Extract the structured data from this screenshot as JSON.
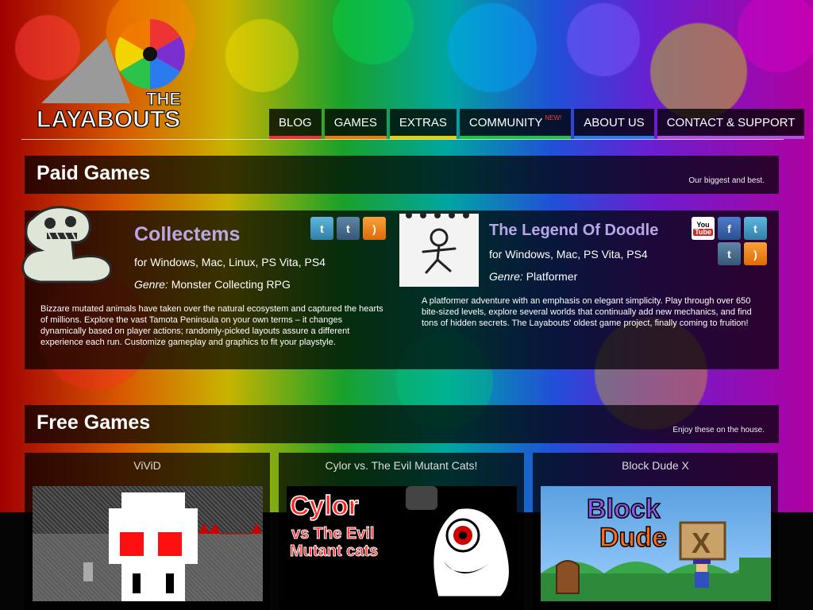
{
  "colors": {
    "nav_blog": "#e33",
    "nav_games": "#f07a00",
    "nav_extras": "#e6cf00",
    "nav_community": "#1ec23c",
    "nav_about": "#2a7bf0",
    "nav_contact": "#b050e0",
    "title_link": "#b9a6e6"
  },
  "logo": {
    "text": "THE LAYABOUTS"
  },
  "nav": [
    {
      "label": "BLOG"
    },
    {
      "label": "GAMES"
    },
    {
      "label": "EXTRAS"
    },
    {
      "label": "COMMUNITY",
      "badge": "NEW!"
    },
    {
      "label": "ABOUT US"
    },
    {
      "label": "CONTACT & SUPPORT"
    }
  ],
  "paid": {
    "heading": "Paid Games",
    "tagline": "Our biggest and best.",
    "games": [
      {
        "title": "Collectems",
        "platforms": "for Windows, Mac, Linux, PS Vita, PS4",
        "genre_label": "Genre:",
        "genre": " Monster Collecting RPG",
        "description": "Bizzare mutated animals have taken over the natural ecosystem and captured the hearts of millions. Explore the vast Tamota Peninsula on your own terms – it changes dynamically based on player actions; randomly-picked layouts assure a different experience each run. Customize gameplay and graphics to fit your playstyle.",
        "social_icons": [
          "twitter-icon",
          "tumblr-icon",
          "rss-icon"
        ]
      },
      {
        "title": "The Legend Of Doodle",
        "platforms": "for Windows, Mac, PS Vita, PS4",
        "genre_label": "Genre:",
        "genre": " Platformer",
        "description": "A platformer adventure with an emphasis on elegant simplicity. Play through over 650 bite-sized levels, explore several worlds that continually add new mechanics, and find tons of hidden secrets. The Layabouts' oldest game project, finally coming to fruition!",
        "social_icons": [
          "youtube-icon",
          "facebook-icon",
          "twitter-icon",
          "tumblr-icon",
          "rss-icon"
        ]
      }
    ]
  },
  "free": {
    "heading": "Free Games",
    "tagline": "Enjoy these on the house.",
    "games": [
      {
        "title": "ViViD"
      },
      {
        "title": "Cylor vs. The Evil Mutant Cats!",
        "art_text": [
          "Cylor",
          "vs The Evil",
          "Mutant cats"
        ]
      },
      {
        "title": "Block Dude X",
        "art_text": [
          "Block",
          "Dude"
        ],
        "art_badge": "X"
      }
    ]
  }
}
